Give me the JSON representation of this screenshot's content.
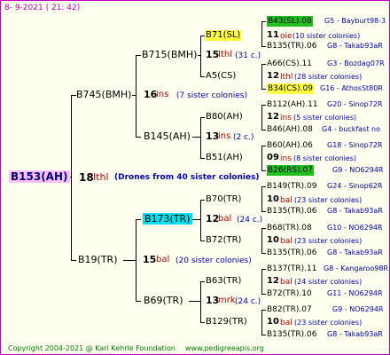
{
  "header": {
    "date": "8-  9-2021  ( 21:  42)"
  },
  "footer": {
    "copyright": "Copyright 2004-2021 @ Karl Kehrle Foundation",
    "url": "www.pedigreeapis.org"
  },
  "root": {
    "name": "B153(AH)",
    "gen": "18",
    "breed": "Ithl",
    "note": "(Drones from 40 sister colonies)"
  },
  "gen1": [
    {
      "name": "B745(BMH)",
      "gen": "16",
      "breed": "ins",
      "note": "(7 sister colonies)"
    },
    {
      "name": "B19(TR)",
      "gen": "15",
      "breed": "bal",
      "note": "(20 sister colonies)"
    }
  ],
  "gen2": [
    {
      "name": "B715(BMH)",
      "gen": "15",
      "breed": "Ithl",
      "note": "(31 c.)"
    },
    {
      "name": "B145(AH)",
      "gen": "13",
      "breed": "ins",
      "note": "(2 c.)"
    },
    {
      "name": "B173(TR)",
      "gen": "12",
      "breed": "bal",
      "note": "(24 c.)"
    },
    {
      "name": "B69(TR)",
      "gen": "13",
      "breed": "mrk",
      "note": "(24 c.)"
    }
  ],
  "gen3": [
    {
      "name": "B71(SL)",
      "gen": "11",
      "breed": "oie",
      "note": "(10 sister colonies)"
    },
    {
      "name": "A5(CS)",
      "gen": "12",
      "breed": "Ithl",
      "note": "(28 sister colonies)"
    },
    {
      "name": "B80(AH)",
      "gen": "12",
      "breed": "ins",
      "note": "(5 sister colonies)"
    },
    {
      "name": "B51(AH)",
      "gen": "09",
      "breed": "ins",
      "note": "(8 sister colonies)"
    },
    {
      "name": "B70(TR)",
      "gen": "10",
      "breed": "bal",
      "note": "(23 sister colonies)"
    },
    {
      "name": "B72(TR)",
      "gen": "10",
      "breed": "bal",
      "note": "(23 sister colonies)"
    },
    {
      "name": "B63(TR)",
      "gen": "12",
      "breed": "bal",
      "note": "(24 sister colonies)"
    },
    {
      "name": "B129(TR)",
      "gen": "10",
      "breed": "bal",
      "note": "(23 sister colonies)"
    }
  ],
  "gen4": [
    {
      "left": "B43(SL).08",
      "right": "G5 - Bayburt98-3"
    },
    {
      "left": "B135(TR).06",
      "right": "G8 - Takab93aR"
    },
    {
      "left": "A66(CS).11",
      "right": "G3 - Bozdag07R"
    },
    {
      "left": "B34(CS).09",
      "right": "G16 - AthosSt80R"
    },
    {
      "left": "B112(AH).11",
      "right": "G20 - Sinop72R"
    },
    {
      "left": "B46(AH).08",
      "right": "G4 - buckfast no"
    },
    {
      "left": "B60(AH).06",
      "right": "G18 - Sinop72R"
    },
    {
      "left": "B26(RS).07",
      "right": "G9 - NO6294R"
    },
    {
      "left": "B149(TR).09",
      "right": "G24 - Sinop62R"
    },
    {
      "left": "B135(TR).06",
      "right": "G8 - Takab93aR"
    },
    {
      "left": "B68(TR).08",
      "right": "G10 - NO6294R"
    },
    {
      "left": "B135(TR).06",
      "right": "G8 - Takab93aR"
    },
    {
      "left": "B137(TR).11",
      "right": "G8 - Kangaroo98R"
    },
    {
      "left": "B72(TR).10",
      "right": "G11 - NO6294R"
    },
    {
      "left": "B82(TR).07",
      "right": "G9 - NO6294R"
    },
    {
      "left": "B135(TR).06",
      "right": "G8 - Takab93aR"
    }
  ],
  "colors": {
    "border": "#c000c0",
    "background": "#fffff0",
    "highlight_root": "#ffc0ff",
    "highlight_cyan": "#00e0f0",
    "highlight_yellow": "#ffff40",
    "highlight_green": "#20c020"
  }
}
